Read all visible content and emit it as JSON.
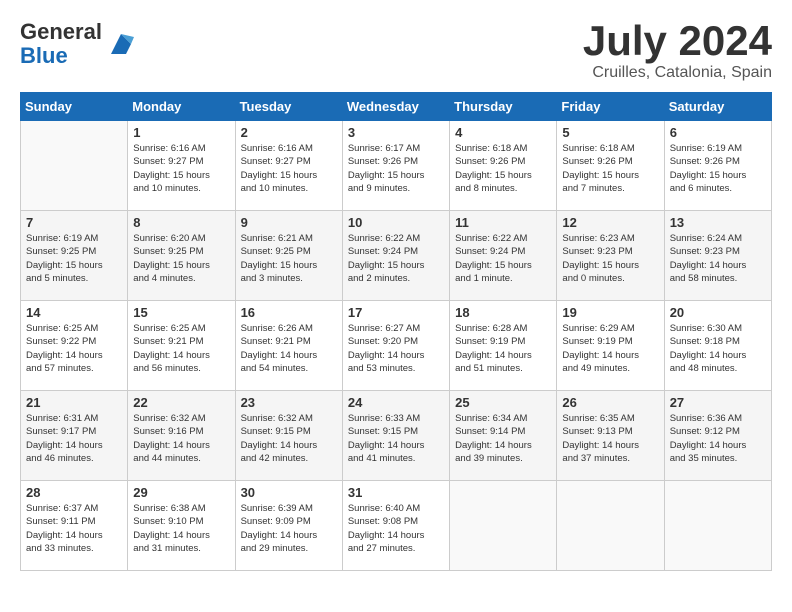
{
  "header": {
    "logo_general": "General",
    "logo_blue": "Blue",
    "month_title": "July 2024",
    "location": "Cruilles, Catalonia, Spain"
  },
  "calendar": {
    "days_of_week": [
      "Sunday",
      "Monday",
      "Tuesday",
      "Wednesday",
      "Thursday",
      "Friday",
      "Saturday"
    ],
    "weeks": [
      [
        {
          "day": "",
          "info": ""
        },
        {
          "day": "1",
          "info": "Sunrise: 6:16 AM\nSunset: 9:27 PM\nDaylight: 15 hours\nand 10 minutes."
        },
        {
          "day": "2",
          "info": "Sunrise: 6:16 AM\nSunset: 9:27 PM\nDaylight: 15 hours\nand 10 minutes."
        },
        {
          "day": "3",
          "info": "Sunrise: 6:17 AM\nSunset: 9:26 PM\nDaylight: 15 hours\nand 9 minutes."
        },
        {
          "day": "4",
          "info": "Sunrise: 6:18 AM\nSunset: 9:26 PM\nDaylight: 15 hours\nand 8 minutes."
        },
        {
          "day": "5",
          "info": "Sunrise: 6:18 AM\nSunset: 9:26 PM\nDaylight: 15 hours\nand 7 minutes."
        },
        {
          "day": "6",
          "info": "Sunrise: 6:19 AM\nSunset: 9:26 PM\nDaylight: 15 hours\nand 6 minutes."
        }
      ],
      [
        {
          "day": "7",
          "info": "Sunrise: 6:19 AM\nSunset: 9:25 PM\nDaylight: 15 hours\nand 5 minutes."
        },
        {
          "day": "8",
          "info": "Sunrise: 6:20 AM\nSunset: 9:25 PM\nDaylight: 15 hours\nand 4 minutes."
        },
        {
          "day": "9",
          "info": "Sunrise: 6:21 AM\nSunset: 9:25 PM\nDaylight: 15 hours\nand 3 minutes."
        },
        {
          "day": "10",
          "info": "Sunrise: 6:22 AM\nSunset: 9:24 PM\nDaylight: 15 hours\nand 2 minutes."
        },
        {
          "day": "11",
          "info": "Sunrise: 6:22 AM\nSunset: 9:24 PM\nDaylight: 15 hours\nand 1 minute."
        },
        {
          "day": "12",
          "info": "Sunrise: 6:23 AM\nSunset: 9:23 PM\nDaylight: 15 hours\nand 0 minutes."
        },
        {
          "day": "13",
          "info": "Sunrise: 6:24 AM\nSunset: 9:23 PM\nDaylight: 14 hours\nand 58 minutes."
        }
      ],
      [
        {
          "day": "14",
          "info": "Sunrise: 6:25 AM\nSunset: 9:22 PM\nDaylight: 14 hours\nand 57 minutes."
        },
        {
          "day": "15",
          "info": "Sunrise: 6:25 AM\nSunset: 9:21 PM\nDaylight: 14 hours\nand 56 minutes."
        },
        {
          "day": "16",
          "info": "Sunrise: 6:26 AM\nSunset: 9:21 PM\nDaylight: 14 hours\nand 54 minutes."
        },
        {
          "day": "17",
          "info": "Sunrise: 6:27 AM\nSunset: 9:20 PM\nDaylight: 14 hours\nand 53 minutes."
        },
        {
          "day": "18",
          "info": "Sunrise: 6:28 AM\nSunset: 9:19 PM\nDaylight: 14 hours\nand 51 minutes."
        },
        {
          "day": "19",
          "info": "Sunrise: 6:29 AM\nSunset: 9:19 PM\nDaylight: 14 hours\nand 49 minutes."
        },
        {
          "day": "20",
          "info": "Sunrise: 6:30 AM\nSunset: 9:18 PM\nDaylight: 14 hours\nand 48 minutes."
        }
      ],
      [
        {
          "day": "21",
          "info": "Sunrise: 6:31 AM\nSunset: 9:17 PM\nDaylight: 14 hours\nand 46 minutes."
        },
        {
          "day": "22",
          "info": "Sunrise: 6:32 AM\nSunset: 9:16 PM\nDaylight: 14 hours\nand 44 minutes."
        },
        {
          "day": "23",
          "info": "Sunrise: 6:32 AM\nSunset: 9:15 PM\nDaylight: 14 hours\nand 42 minutes."
        },
        {
          "day": "24",
          "info": "Sunrise: 6:33 AM\nSunset: 9:15 PM\nDaylight: 14 hours\nand 41 minutes."
        },
        {
          "day": "25",
          "info": "Sunrise: 6:34 AM\nSunset: 9:14 PM\nDaylight: 14 hours\nand 39 minutes."
        },
        {
          "day": "26",
          "info": "Sunrise: 6:35 AM\nSunset: 9:13 PM\nDaylight: 14 hours\nand 37 minutes."
        },
        {
          "day": "27",
          "info": "Sunrise: 6:36 AM\nSunset: 9:12 PM\nDaylight: 14 hours\nand 35 minutes."
        }
      ],
      [
        {
          "day": "28",
          "info": "Sunrise: 6:37 AM\nSunset: 9:11 PM\nDaylight: 14 hours\nand 33 minutes."
        },
        {
          "day": "29",
          "info": "Sunrise: 6:38 AM\nSunset: 9:10 PM\nDaylight: 14 hours\nand 31 minutes."
        },
        {
          "day": "30",
          "info": "Sunrise: 6:39 AM\nSunset: 9:09 PM\nDaylight: 14 hours\nand 29 minutes."
        },
        {
          "day": "31",
          "info": "Sunrise: 6:40 AM\nSunset: 9:08 PM\nDaylight: 14 hours\nand 27 minutes."
        },
        {
          "day": "",
          "info": ""
        },
        {
          "day": "",
          "info": ""
        },
        {
          "day": "",
          "info": ""
        }
      ]
    ]
  }
}
